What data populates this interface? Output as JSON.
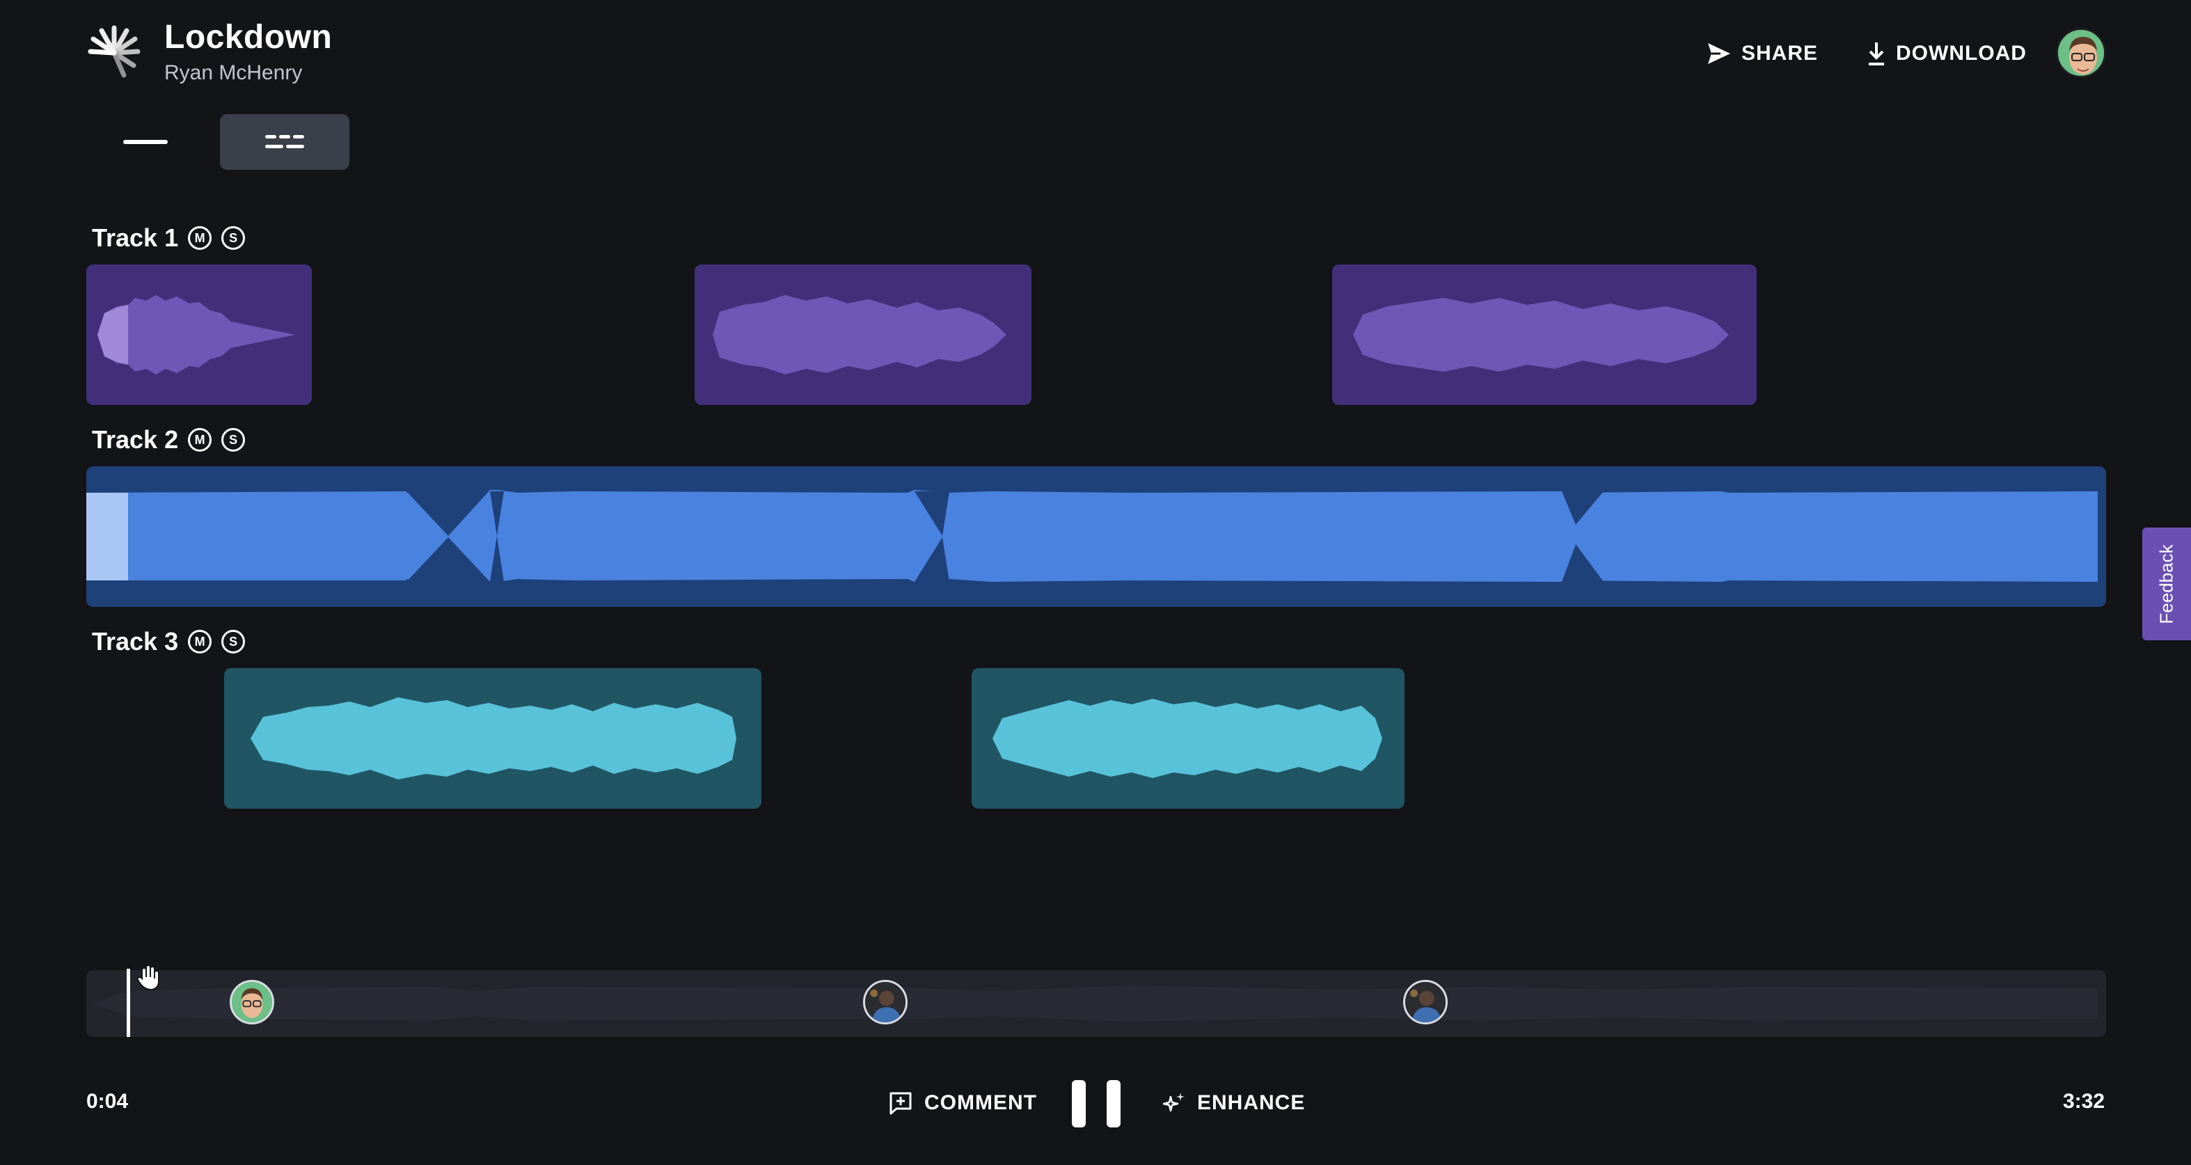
{
  "project": {
    "title": "Lockdown",
    "artist": "Ryan McHenry"
  },
  "header": {
    "share_label": "SHARE",
    "download_label": "DOWNLOAD"
  },
  "view_toggle": {
    "selected": "multi-track"
  },
  "tracks": [
    {
      "label": "Track 1",
      "mute": "M",
      "solo": "S",
      "color": "#6e57b7",
      "clip_bg": "#432f79"
    },
    {
      "label": "Track 2",
      "mute": "M",
      "solo": "S",
      "color": "#4a82e0",
      "clip_bg": "#1f4179"
    },
    {
      "label": "Track 3",
      "mute": "M",
      "solo": "S",
      "color": "#58c2d9",
      "clip_bg": "#205563"
    }
  ],
  "transport": {
    "current_time": "0:04",
    "total_time": "3:32",
    "comment_label": "COMMENT",
    "enhance_label": "ENHANCE",
    "state": "playing"
  },
  "feedback_label": "Feedback",
  "colors": {
    "background": "#131418",
    "accent": "#6b50b3",
    "played": "#a9c6f5"
  }
}
